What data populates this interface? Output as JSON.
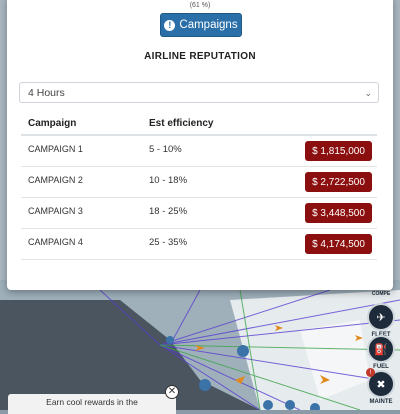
{
  "modal": {
    "percent_text": "(61 %)",
    "campaigns_button": "Campaigns",
    "title": "AIRLINE REPUTATION",
    "duration_select": "4 Hours",
    "table": {
      "headers": [
        "Campaign",
        "Est efficiency"
      ],
      "rows": [
        {
          "campaign": "CAMPAIGN 1",
          "efficiency": "5 - 10%",
          "price": "$ 1,815,000"
        },
        {
          "campaign": "CAMPAIGN 2",
          "efficiency": "10 - 18%",
          "price": "$ 2,722,500"
        },
        {
          "campaign": "CAMPAIGN 3",
          "efficiency": "18 - 25%",
          "price": "$ 3,448,500"
        },
        {
          "campaign": "CAMPAIGN 4",
          "efficiency": "25 - 35%",
          "price": "$ 4,174,500"
        }
      ]
    }
  },
  "sidebar": {
    "items": [
      {
        "label": "FLEET",
        "icon": "airplane-icon"
      },
      {
        "label": "FUEL",
        "icon": "fuel-icon"
      },
      {
        "label": "MAINTE",
        "icon": "wrench-icon",
        "badge": "!"
      }
    ],
    "partial_label": "COMPE"
  },
  "banner": {
    "text": "Earn cool rewards in the",
    "close": "✕"
  },
  "colors": {
    "accent_blue": "#2a6fa8",
    "price_red": "#8b0f0f"
  }
}
